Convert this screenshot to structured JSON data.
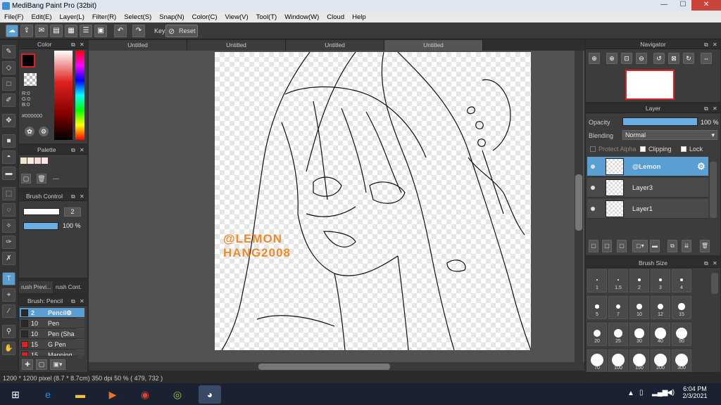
{
  "window": {
    "title": "MediBang Paint Pro (32bit)",
    "min": "—",
    "max": "☐",
    "close": "✕"
  },
  "menu": [
    "File(F)",
    "Edit(E)",
    "Layer(L)",
    "Filter(R)",
    "Select(S)",
    "Snap(N)",
    "Color(C)",
    "View(V)",
    "Tool(T)",
    "Window(W)",
    "Cloud",
    "Help"
  ],
  "toolbar": {
    "key_label": "Key",
    "reset_label": "Reset"
  },
  "tabs": [
    "Untitled",
    "Untitled",
    "Untitled",
    "Untitled"
  ],
  "color_panel": {
    "title": "Color",
    "r": "R:0",
    "g": "G:0",
    "b": "B:0",
    "hex": "#000000",
    "main_color": "#000000",
    "accent": "#e02020"
  },
  "palette_panel": {
    "title": "Palette",
    "swatches": [
      "#f2e6c8",
      "#f7ecdd",
      "#f9d9d2",
      "#fde4e4",
      "#ffffff"
    ],
    "dash": "---"
  },
  "brush_control": {
    "title": "Brush Control",
    "size": "2",
    "opacity": "100 %"
  },
  "panel_tabs": [
    "rush Previ...",
    "rush Cont."
  ],
  "brush_list": {
    "title": "Brush: Pencil",
    "items": [
      {
        "size": "2",
        "name": "Pencil",
        "color": "#2a2a2a"
      },
      {
        "size": "10",
        "name": "Pen",
        "color": "#2a2a2a"
      },
      {
        "size": "10",
        "name": "Pen (Sha",
        "color": "#2a2a2a"
      },
      {
        "size": "15",
        "name": "G Pen",
        "color": "#e02020"
      },
      {
        "size": "15",
        "name": "Mapping",
        "color": "#e02020"
      }
    ]
  },
  "canvas": {
    "watermark_line1": "@LEMON",
    "watermark_line2": "HANG2008"
  },
  "navigator": {
    "title": "Navigator"
  },
  "layer_panel": {
    "title": "Layer",
    "opacity_label": "Opacity",
    "opacity_value": "100 %",
    "opacity_fraction": 1.0,
    "blending_label": "Blending",
    "blending_value": "Normal",
    "protect_alpha": "Protect Alpha",
    "clipping": "Clipping",
    "lock": "Lock",
    "layers": [
      "@Lemon",
      "Layer3",
      "Layer1"
    ]
  },
  "brush_size_panel": {
    "title": "Brush Size",
    "sizes": [
      "1",
      "1.5",
      "2",
      "3",
      "4",
      "5",
      "7",
      "10",
      "12",
      "15",
      "20",
      "25",
      "30",
      "40",
      "50",
      "70",
      "100",
      "150",
      "200",
      "300"
    ]
  },
  "status": {
    "text": "1200 * 1200 pixel   (8.7 * 8.7cm)   350 dpi   50 %   ( 479, 732 )"
  },
  "taskbar": {
    "time": "6:04 PM",
    "date": "2/3/2021"
  }
}
